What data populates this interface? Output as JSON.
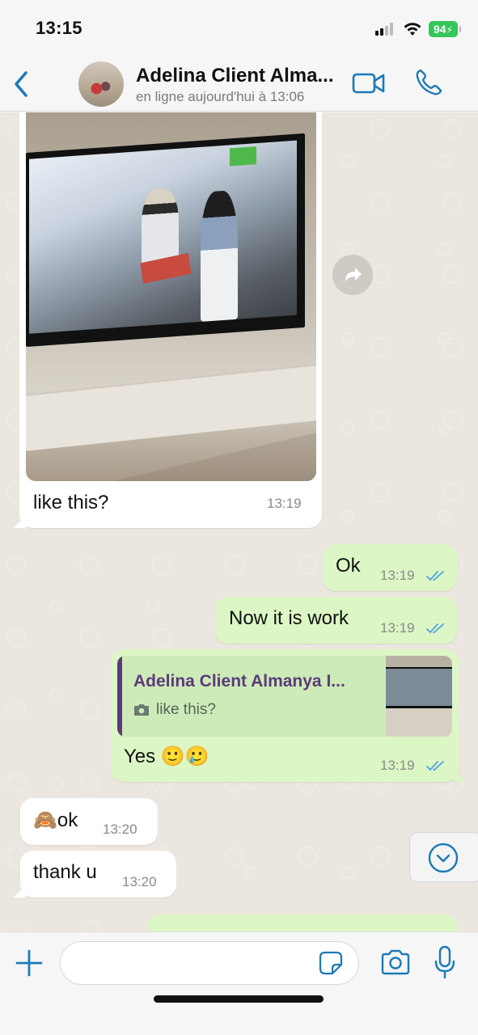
{
  "status_bar": {
    "time": "13:15",
    "battery": "94",
    "battery_color": "#34c759"
  },
  "header": {
    "back_icon": "chevron-left-icon",
    "contact_name": "Adelina Client Alma...",
    "contact_status": "en ligne aujourd'hui à 13:06",
    "video_icon": "video-camera-icon",
    "call_icon": "phone-icon",
    "accent_color": "#1a7ab8"
  },
  "messages": [
    {
      "direction": "incoming",
      "type": "image",
      "caption": "like this?",
      "time": "13:19"
    },
    {
      "direction": "outgoing",
      "text": "Ok",
      "time": "13:19",
      "status": "read"
    },
    {
      "direction": "outgoing",
      "text": "Now it is work",
      "time": "13:19",
      "status": "read"
    },
    {
      "direction": "outgoing",
      "type": "reply",
      "quote": {
        "author": "Adelina Client Almanya I...",
        "text": "like this?",
        "icon": "camera-icon"
      },
      "text": "Yes 🙂🥲",
      "time": "13:19",
      "status": "read"
    },
    {
      "direction": "incoming",
      "text": "🙈ok",
      "time": "13:20"
    },
    {
      "direction": "incoming",
      "text": "thank u",
      "time": "13:20"
    },
    {
      "direction": "outgoing",
      "text": "",
      "partial": true
    }
  ],
  "colors": {
    "outgoing_bubble": "#dcf7c5",
    "incoming_bubble": "#ffffff",
    "read_ticks": "#4fa3e0",
    "quote_author": "#5d3a7a"
  },
  "input": {
    "placeholder": "",
    "value": ""
  }
}
